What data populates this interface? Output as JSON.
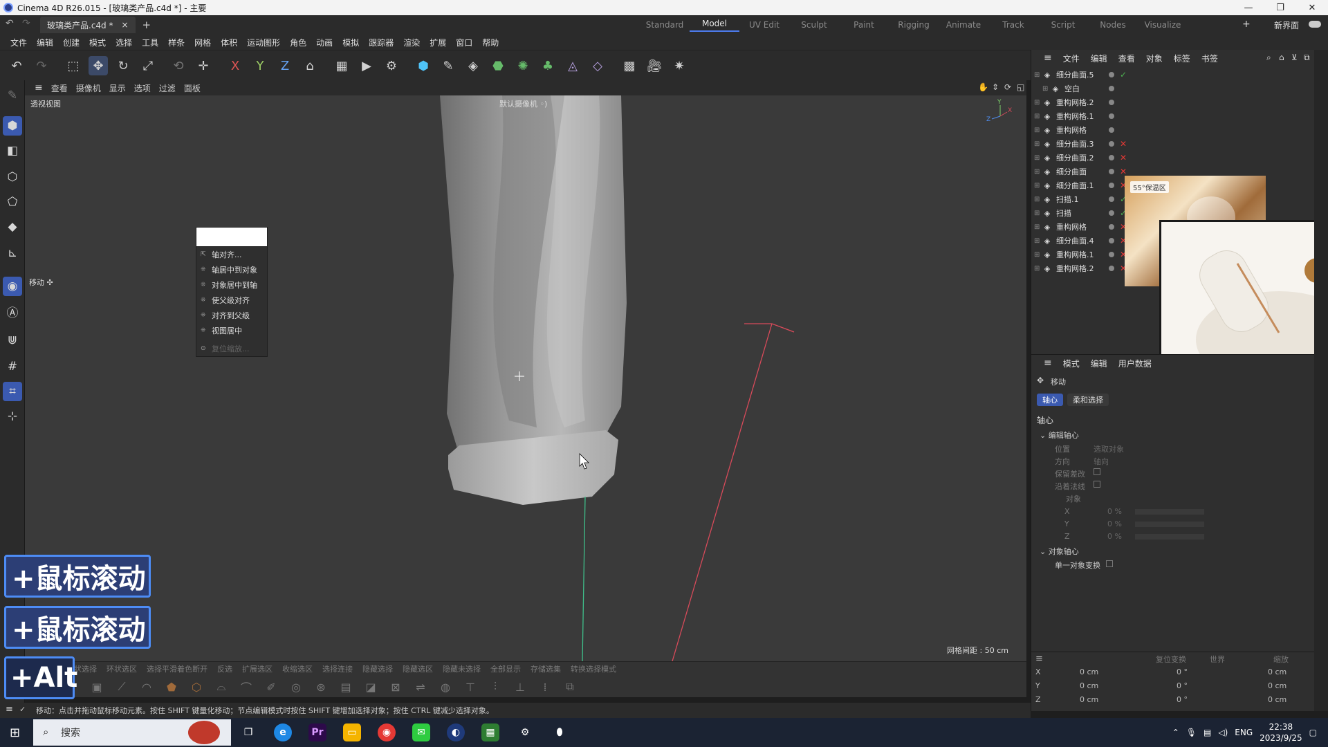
{
  "window": {
    "title": "Cinema 4D R26.015 - [玻璃类产品.c4d *] - 主要",
    "controls": [
      "—",
      "❐",
      "✕"
    ]
  },
  "tabs": {
    "document": "玻璃类产品.c4d *",
    "close": "×",
    "new": "+"
  },
  "layouts": [
    "Standard",
    "Model",
    "UV Edit",
    "Sculpt",
    "Paint",
    "Rigging",
    "Animate",
    "Track",
    "Script",
    "Nodes",
    "Visualize"
  ],
  "layouts_extra": {
    "add": "+",
    "new_ui": "新界面"
  },
  "menu": [
    "文件",
    "编辑",
    "创建",
    "模式",
    "选择",
    "工具",
    "样条",
    "网格",
    "体积",
    "运动图形",
    "角色",
    "动画",
    "模拟",
    "跟踪器",
    "渲染",
    "扩展",
    "窗口",
    "帮助"
  ],
  "viewport": {
    "menu": [
      "查看",
      "摄像机",
      "显示",
      "选项",
      "过滤",
      "面板"
    ],
    "label": "透视视图",
    "camera": "默认摄像机 ◦)",
    "grid_spacing": "网格间距 : 50 cm",
    "move_hint": "移动 ✣"
  },
  "context_menu": {
    "items": [
      "轴对齐...",
      "轴居中到对象",
      "对象居中到轴",
      "使父级对齐",
      "对齐到父级",
      "视图居中"
    ],
    "disabled_item": "复位缩放..."
  },
  "bottom_selection_row": [
    "环状选择",
    "环状选区",
    "选择平滑着色断开",
    "反选",
    "扩展选区",
    "收缩选区",
    "选择连接",
    "隐藏选择",
    "隐藏选区",
    "隐藏未选择",
    "全部显示",
    "存储选集",
    "转换选择模式"
  ],
  "status": "移动：点击并拖动鼠标移动元素。按住 SHIFT 键量化移动；节点编辑模式时按住 SHIFT 键增加选择对象；按住 CTRL 键减少选择对象。",
  "object_manager": {
    "menu": [
      "文件",
      "编辑",
      "查看",
      "对象",
      "标签",
      "书签"
    ],
    "objects": [
      {
        "name": "细分曲面.5",
        "status": "✓",
        "status_color": "#4caf50"
      },
      {
        "name": "空白",
        "status": "",
        "status_color": "#888"
      },
      {
        "name": "重构网格.2",
        "status": "",
        "status_color": "#888"
      },
      {
        "name": "重构网格.1",
        "status": "",
        "status_color": "#888"
      },
      {
        "name": "重构网格",
        "status": "",
        "status_color": "#888"
      },
      {
        "name": "细分曲面.3",
        "status": "✕",
        "status_color": "#e53935"
      },
      {
        "name": "细分曲面.2",
        "status": "✕",
        "status_color": "#e53935"
      },
      {
        "name": "细分曲面",
        "status": "✕",
        "status_color": "#e53935"
      },
      {
        "name": "细分曲面.1",
        "status": "✕",
        "status_color": "#e53935"
      },
      {
        "name": "扫描.1",
        "status": "✓",
        "status_color": "#4caf50"
      },
      {
        "name": "扫描",
        "status": "✓",
        "status_color": "#4caf50"
      },
      {
        "name": "重构网格",
        "status": "✕",
        "status_color": "#e53935"
      },
      {
        "name": "细分曲面.4",
        "status": "✕",
        "status_color": "#e53935"
      },
      {
        "name": "重构网格.1",
        "status": "✕",
        "status_color": "#e53935"
      },
      {
        "name": "重构网格.2",
        "status": "✕",
        "status_color": "#e53935"
      }
    ],
    "image_tag": "55°保温区"
  },
  "attributes": {
    "menu": [
      "模式",
      "编辑",
      "用户数据"
    ],
    "tool": "移动",
    "tabs": [
      "轴心",
      "柔和选择"
    ],
    "section": "轴心",
    "group1": "编辑轴心",
    "pos_label": "位置",
    "pos_value": "选取对象",
    "dir_label": "方向",
    "dir_value": "轴向",
    "keep_label": "保留差改",
    "normal_label": "沿着法线",
    "object_label": "对象",
    "x_label": "X",
    "x_value": "0 %",
    "y_label": "Y",
    "y_value": "0 %",
    "z_label": "Z",
    "z_value": "0 %",
    "group2": "对象轴心",
    "single_label": "单一对象变换"
  },
  "coordinates": {
    "header": [
      "复位变换",
      "世界",
      "缩放"
    ],
    "rows": [
      {
        "axis": "X",
        "pos": "0 cm",
        "rot": "0 °",
        "scale": "0 cm"
      },
      {
        "axis": "Y",
        "pos": "0 cm",
        "rot": "0 °",
        "scale": "0 cm"
      },
      {
        "axis": "Z",
        "pos": "0 cm",
        "rot": "0 °",
        "scale": "0 cm"
      }
    ]
  },
  "key_hints": [
    "+鼠标滚动",
    "+鼠标滚动",
    "+Alt"
  ],
  "taskbar": {
    "search": "搜索",
    "lang": "ENG",
    "time": "22:38",
    "date": "2023/9/25"
  }
}
